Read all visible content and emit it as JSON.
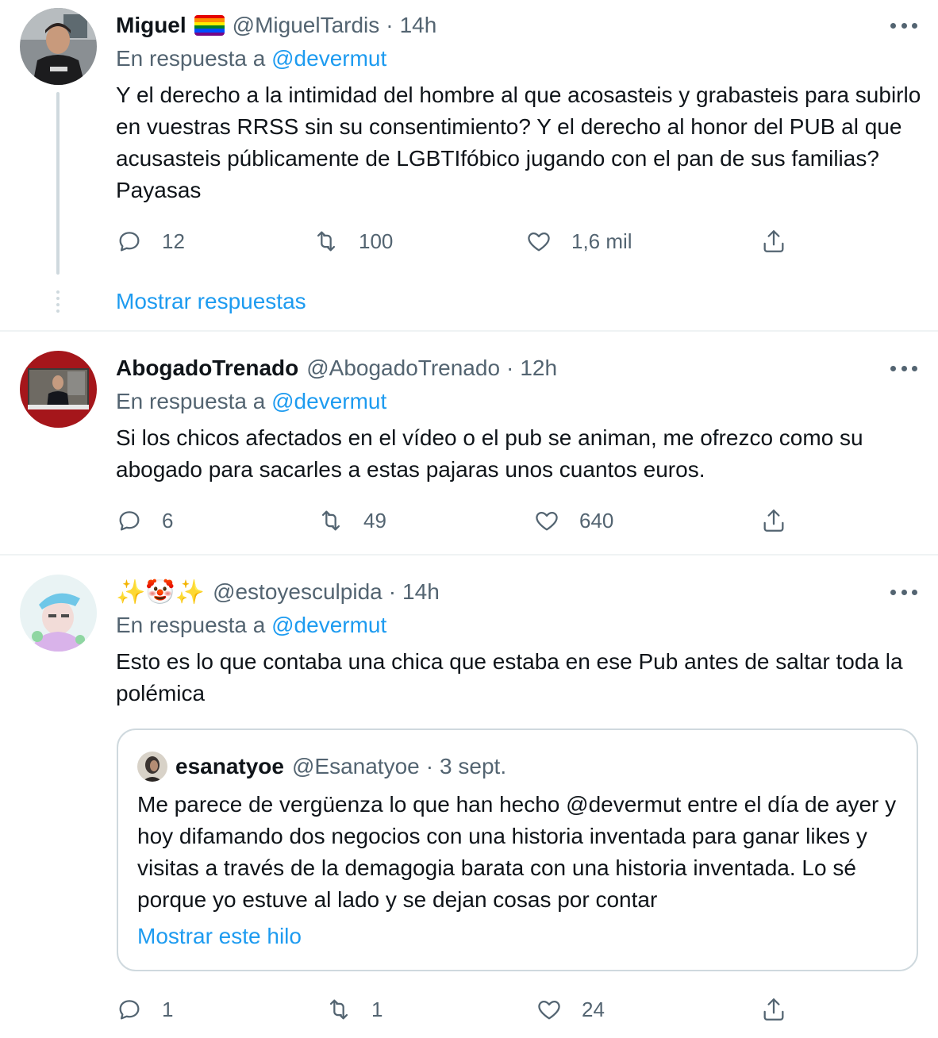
{
  "tweets": [
    {
      "name": "Miguel",
      "name_badge": "rainbow-flag",
      "handle": "@MiguelTardis",
      "time": "14h",
      "reply_prefix": "En respuesta a",
      "reply_mention": "@devermut",
      "text": "Y el derecho a la intimidad del hombre al que acosasteis y grabasteis para subirlo en vuestras RRSS sin su consentimiento? Y el derecho al honor del PUB al que acusasteis públicamente de LGBTIfóbico jugando con el pan de sus familias?  Payasas",
      "reply_count": "12",
      "retweet_count": "100",
      "like_count": "1,6 mil",
      "show_replies": "Mostrar respuestas"
    },
    {
      "name": "AbogadoTrenado",
      "handle": "@AbogadoTrenado",
      "time": "12h",
      "reply_prefix": "En respuesta a",
      "reply_mention": "@devermut",
      "text": "Si los chicos afectados en el vídeo o el pub se animan, me ofrezco como su abogado para sacarles a estas pajaras unos cuantos euros.",
      "reply_count": "6",
      "retweet_count": "49",
      "like_count": "640"
    },
    {
      "name": "✨🤡✨",
      "handle": "@estoyesculpida",
      "time": "14h",
      "reply_prefix": "En respuesta a",
      "reply_mention": "@devermut",
      "text": "Esto es lo que contaba una chica que estaba en ese Pub antes de saltar toda la polémica",
      "reply_count": "1",
      "retweet_count": "1",
      "like_count": "24",
      "quote": {
        "name": "esanatyoe",
        "handle": "@Esanatyoe",
        "time": "3 sept.",
        "text": "Me parece de vergüenza lo que han hecho @devermut entre el día de ayer y hoy difamando dos negocios con una historia inventada para ganar likes y visitas a través de la demagogia barata con una historia inventada. Lo sé porque yo estuve al lado y se dejan cosas por contar",
        "show_thread": "Mostrar este hilo"
      }
    }
  ],
  "colors": {
    "link": "#1d9bf0",
    "secondary_text": "#536471",
    "divider": "#eff3f4"
  }
}
